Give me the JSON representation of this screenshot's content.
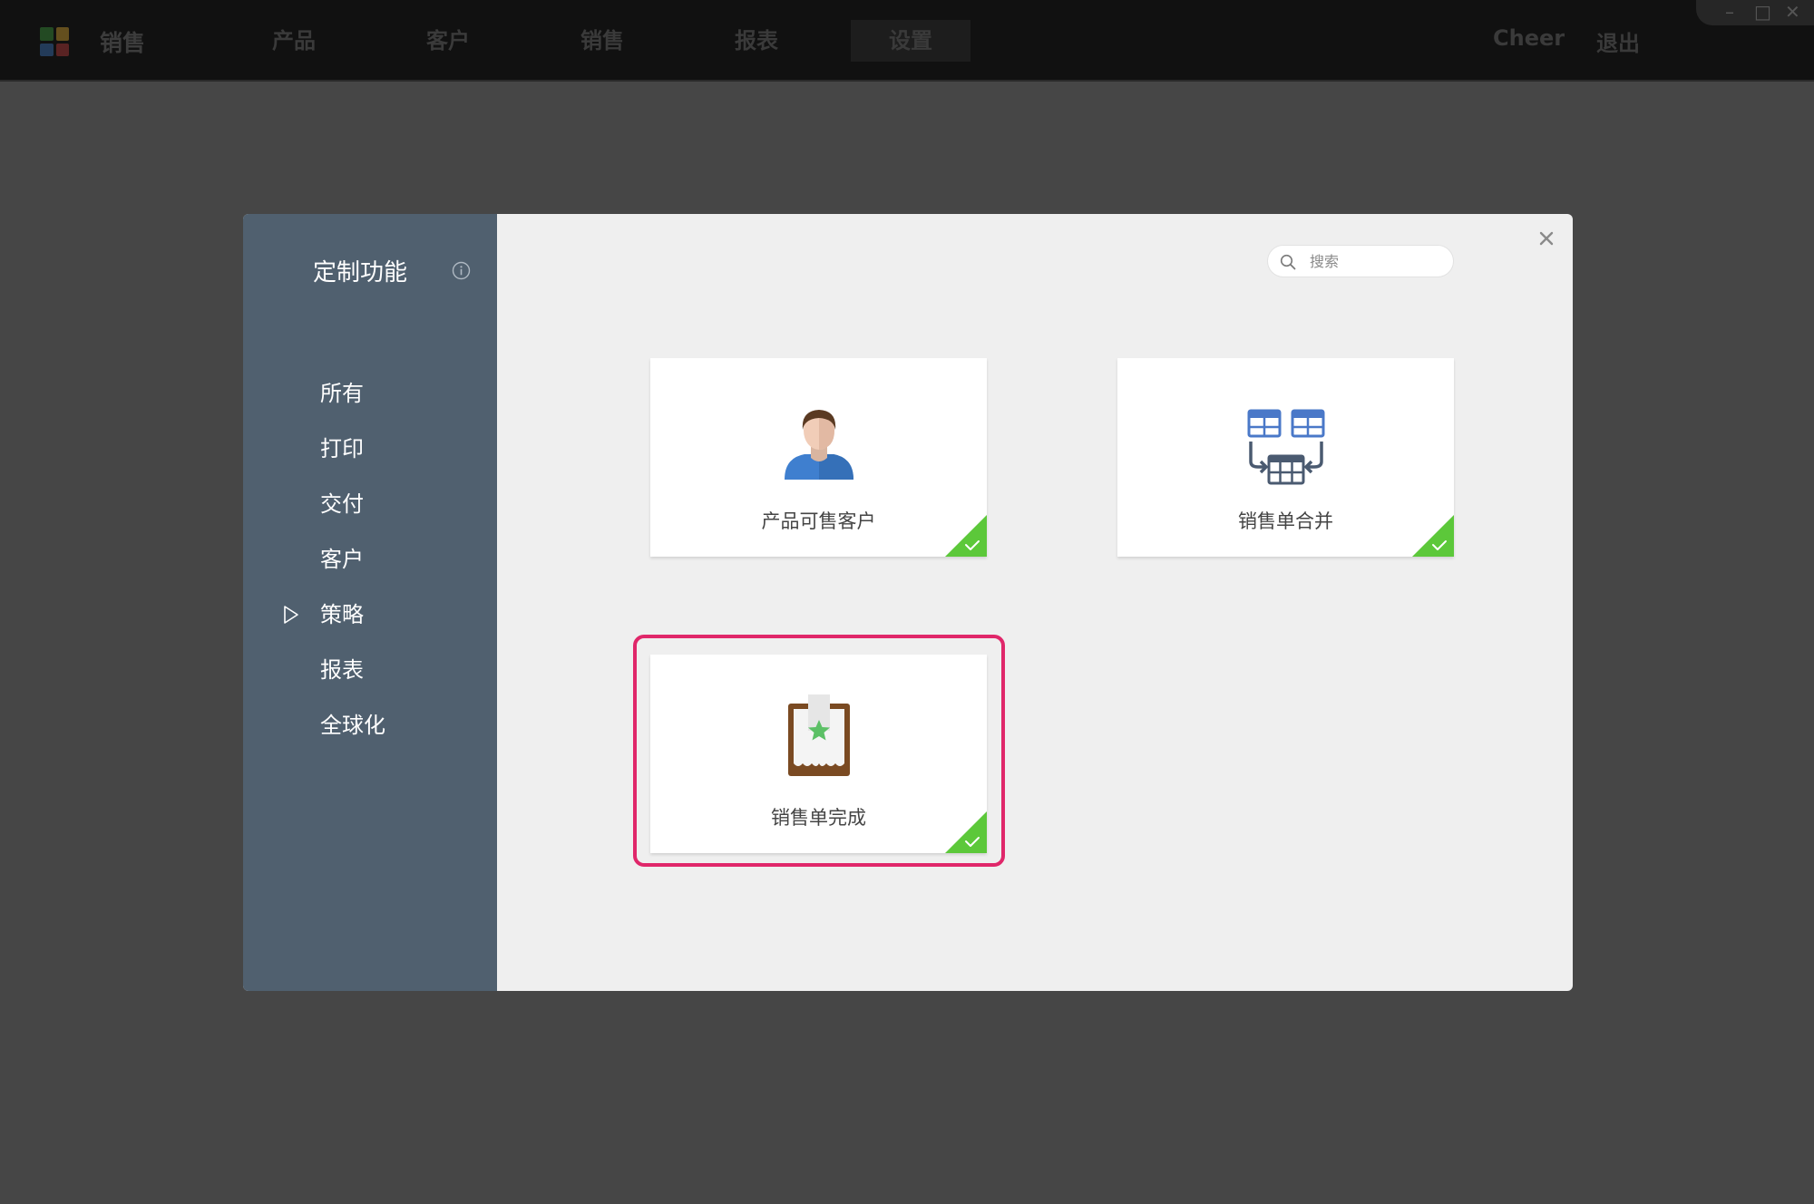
{
  "topbar": {
    "app_name": "销售",
    "nav": [
      {
        "label": "产品"
      },
      {
        "label": "客户"
      },
      {
        "label": "销售"
      },
      {
        "label": "报表"
      },
      {
        "label": "设置"
      }
    ],
    "active_nav": "设置",
    "user_name": "Cheer",
    "logout_label": "退出",
    "window_controls": [
      "minimize-icon",
      "maximize-icon",
      "close-icon"
    ]
  },
  "modal": {
    "sidebar": {
      "title": "定制功能",
      "info_icon": "info-icon",
      "items": [
        {
          "label": "所有"
        },
        {
          "label": "打印"
        },
        {
          "label": "交付"
        },
        {
          "label": "客户"
        },
        {
          "label": "策略"
        },
        {
          "label": "报表"
        },
        {
          "label": "全球化"
        }
      ],
      "selected_item": "策略"
    },
    "search": {
      "placeholder": "搜索",
      "value": ""
    },
    "cards": [
      {
        "label": "产品可售客户",
        "icon": "customer-avatar-icon",
        "enabled": true
      },
      {
        "label": "销售单合并",
        "icon": "merge-tables-icon",
        "enabled": true
      },
      {
        "label": "销售单完成",
        "icon": "order-complete-icon",
        "enabled": true
      }
    ],
    "highlighted_card": "销售单完成"
  },
  "colors": {
    "sidebar_bg": "#50606f",
    "modal_bg": "#efefef",
    "check_green": "#5cc83a",
    "highlight": "#e0276a",
    "overlay_bg": "#464646"
  }
}
